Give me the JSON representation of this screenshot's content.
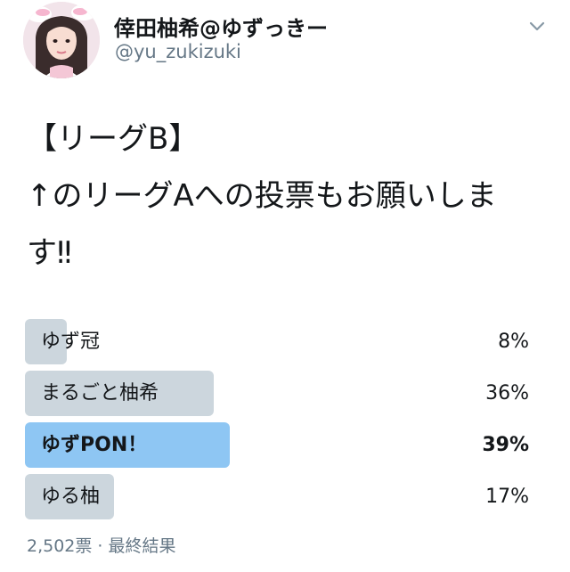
{
  "user": {
    "display_name": "倖田柚希@ゆずっきー",
    "handle": "@yu_zukizuki"
  },
  "tweet": {
    "line1": "【リーグB】",
    "line2": "↑のリーグAへの投票もお願いしま",
    "line3": "す‼︎"
  },
  "poll": {
    "options": [
      {
        "label": "ゆず冠",
        "percent": "8%",
        "fraction": 0.08,
        "winner": false
      },
      {
        "label": "まるごと柚希",
        "percent": "36%",
        "fraction": 0.36,
        "winner": false
      },
      {
        "label": "ゆずPON！",
        "percent": "39%",
        "fraction": 0.39,
        "winner": true
      },
      {
        "label": "ゆる柚",
        "percent": "17%",
        "fraction": 0.17,
        "winner": false
      }
    ],
    "meta": "2,502票 · 最終結果"
  },
  "icons": {
    "avatar": "avatar",
    "menu": "chevron-down-icon"
  },
  "colors": {
    "bar": "#ccd6dd",
    "winner_bar": "#8ec6f3",
    "secondary_text": "#657786"
  }
}
